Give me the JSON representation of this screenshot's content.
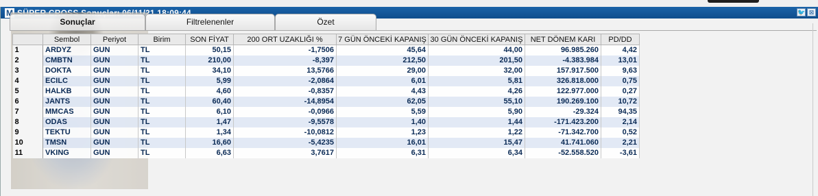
{
  "window": {
    "logo": "M",
    "title": "SÜPER CROSS Sonuçları  06/11/21 18:09:44",
    "btn_twitter": "🐦",
    "btn_close": "⊠"
  },
  "tabs": [
    {
      "label": "Sonuçlar",
      "active": true
    },
    {
      "label": "Filtrelenenler",
      "active": false
    },
    {
      "label": "Özet",
      "active": false
    }
  ],
  "table": {
    "columns": [
      "",
      "Sembol",
      "Periyot",
      "Birim",
      "SON FİYAT",
      "200   ORT UZAKLIĞI %",
      "7 GÜN ÖNCEKİ KAPANIŞ",
      "30 GÜN ÖNCEKİ KAPANIŞ",
      "NET DÖNEM KARI",
      "PD/DD"
    ],
    "rows": [
      [
        "1",
        "ARDYZ",
        "GUN",
        "TL",
        "50,15",
        "-1,7506",
        "45,64",
        "44,00",
        "96.985.260",
        "4,42"
      ],
      [
        "2",
        "CMBTN",
        "GUN",
        "TL",
        "210,00",
        "-8,397",
        "212,50",
        "201,50",
        "-4.383.984",
        "13,01"
      ],
      [
        "3",
        "DOKTA",
        "GUN",
        "TL",
        "34,10",
        "13,5766",
        "29,00",
        "32,00",
        "157.917.500",
        "9,63"
      ],
      [
        "4",
        "ECILC",
        "GUN",
        "TL",
        "5,99",
        "-2,0864",
        "6,01",
        "5,81",
        "326.818.000",
        "0,75"
      ],
      [
        "5",
        "HALKB",
        "GUN",
        "TL",
        "4,60",
        "-0,8357",
        "4,43",
        "4,26",
        "122.977.000",
        "0,27"
      ],
      [
        "6",
        "JANTS",
        "GUN",
        "TL",
        "60,40",
        "-14,8954",
        "62,05",
        "55,10",
        "190.269.100",
        "10,72"
      ],
      [
        "7",
        "MMCAS",
        "GUN",
        "TL",
        "6,10",
        "-0,0966",
        "5,59",
        "5,90",
        "-29.324",
        "94,35"
      ],
      [
        "8",
        "ODAS",
        "GUN",
        "TL",
        "1,47",
        "-9,5578",
        "1,40",
        "1,44",
        "-171.423.200",
        "2,14"
      ],
      [
        "9",
        "TEKTU",
        "GUN",
        "TL",
        "1,34",
        "-10,0812",
        "1,23",
        "1,22",
        "-71.342.700",
        "0,52"
      ],
      [
        "10",
        "TMSN",
        "GUN",
        "TL",
        "16,60",
        "-5,4235",
        "16,01",
        "15,47",
        "41.741.060",
        "2,21"
      ],
      [
        "11",
        "VKING",
        "GUN",
        "TL",
        "6,63",
        "3,7617",
        "6,31",
        "6,34",
        "-52.558.520",
        "-3,61"
      ]
    ]
  }
}
